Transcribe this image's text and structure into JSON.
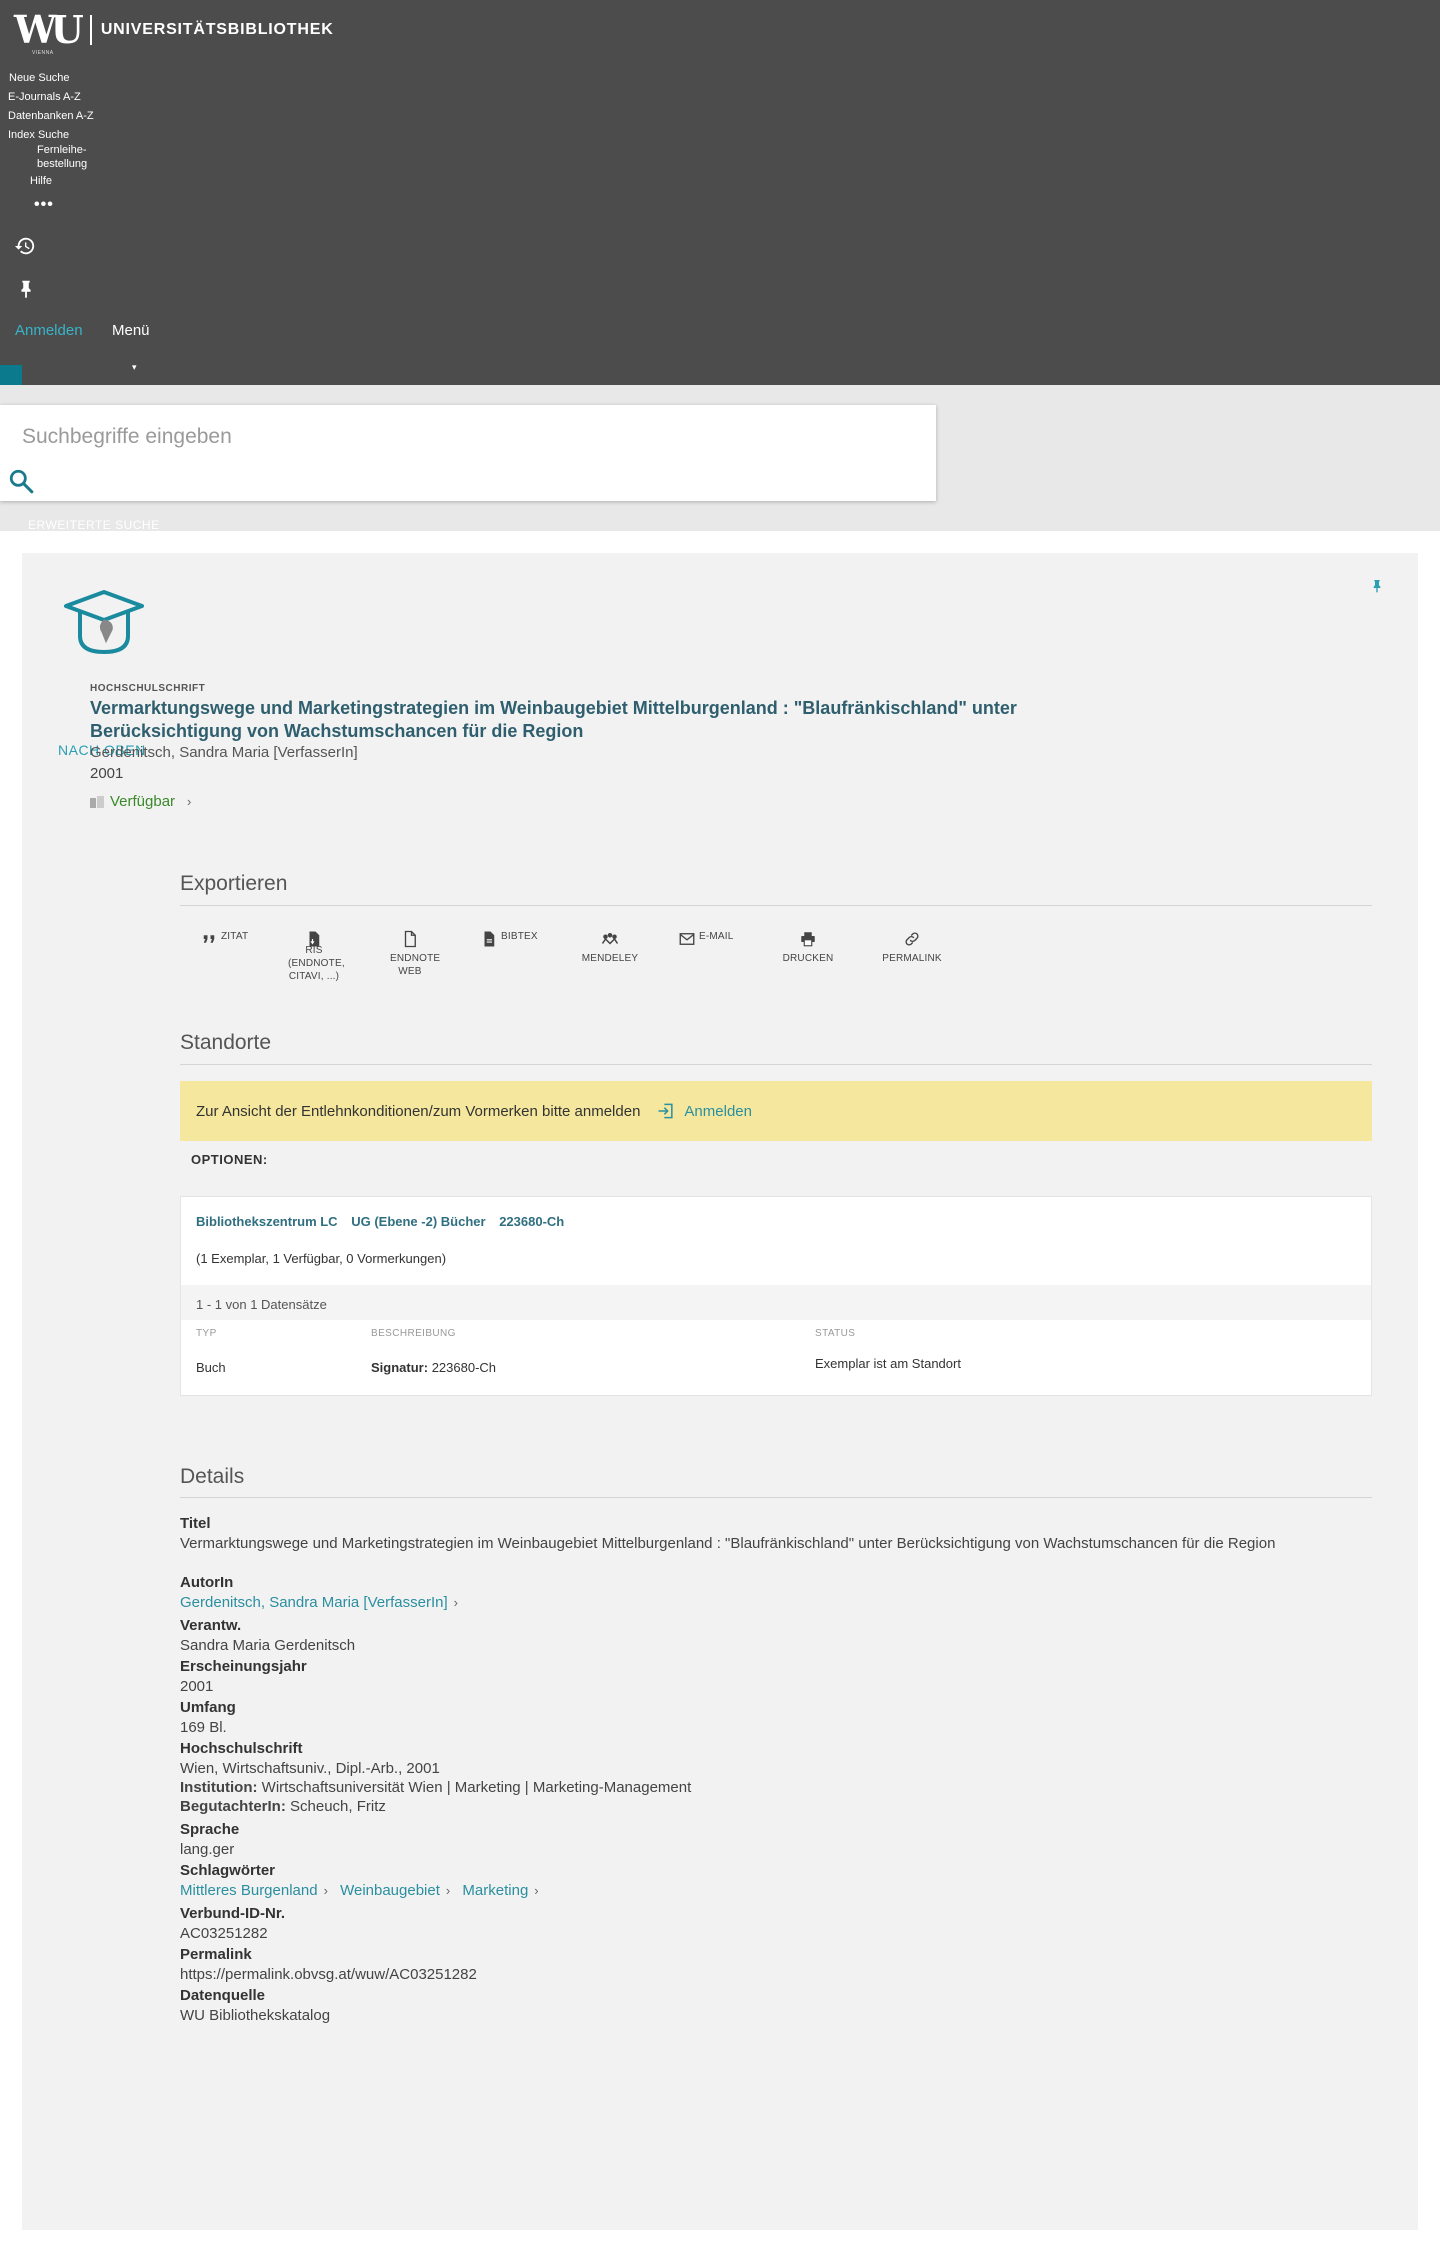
{
  "header": {
    "logo_mark": "WU",
    "logo_sub": "VIENNA",
    "library_name": "UNIVERSITÄTSBIBLIOTHEK",
    "nav": [
      "Neue Suche",
      "E-Journals A-Z",
      "Datenbanken A-Z",
      "Index Suche",
      "Fernleihe-bestellung",
      "Hilfe"
    ],
    "more": "•••",
    "login": "Anmelden",
    "menu": "Menü",
    "caret": "▾"
  },
  "search": {
    "placeholder": "Suchbegriffe eingeben",
    "advanced": "ERWEITERTE SUCHE"
  },
  "record": {
    "type": "HOCHSCHULSCHRIFT",
    "title": "Vermarktungswege und Marketingstrategien im Weinbaugebiet Mittelburgenland : \"Blaufränkischland\" unter Berücksichtigung von Wachstumschancen für die Region",
    "author": "Gerdenitsch, Sandra Maria [VerfasserIn]",
    "year": "2001",
    "availability": "Verfügbar",
    "back_to_top": "NACH OBEN",
    "icon_color": "#1a8a9e",
    "available_color": "#3a8a2a"
  },
  "export": {
    "title": "Exportieren",
    "buttons": [
      {
        "icon": "quote-icon",
        "label": "ZITAT"
      },
      {
        "icon": "ris-file-icon",
        "label": "RIS (ENDNOTE, CITAVI, ...)"
      },
      {
        "icon": "endnote-file-icon",
        "label": "ENDNOTE WEB"
      },
      {
        "icon": "bibtex-file-icon",
        "label": "BIBTEX"
      },
      {
        "icon": "mendeley-icon",
        "label": "MENDELEY"
      },
      {
        "icon": "email-icon",
        "label": "E-MAIL"
      },
      {
        "icon": "print-icon",
        "label": "DRUCKEN"
      },
      {
        "icon": "link-icon",
        "label": "PERMALINK"
      }
    ]
  },
  "locations": {
    "title": "Standorte",
    "login_notice": "Zur Ansicht der Entlehnkonditionen/zum Vormerken bitte anmelden",
    "login_button": "Anmelden",
    "options": "OPTIONEN:",
    "library": "Bibliothekszentrum LC",
    "shelf": "UG (Ebene -2) Bücher",
    "call_number": "223680-Ch",
    "summary": "(1 Exemplar, 1 Verfügbar, 0 Vormerkungen)",
    "range": "1 - 1 von 1 Datensätze",
    "columns": [
      "TYP",
      "BESCHREIBUNG",
      "STATUS"
    ],
    "rows": [
      {
        "type": "Buch",
        "desc_label": "Signatur:",
        "desc_value": "223680-Ch",
        "status": "Exemplar ist am Standort"
      }
    ]
  },
  "details": {
    "title": "Details",
    "titel_label": "Titel",
    "titel_value": "Vermarktungswege und Marketingstrategien im Weinbaugebiet Mittelburgenland : \"Blaufränkischland\" unter Berücksichtigung von Wachstumschancen für die Region",
    "autor_label": "AutorIn",
    "autor_value": "Gerdenitsch, Sandra Maria [VerfasserIn]",
    "verantw_label": "Verantw.",
    "verantw_value": "Sandra Maria Gerdenitsch",
    "jahr_label": "Erscheinungsjahr",
    "jahr_value": "2001",
    "umfang_label": "Umfang",
    "umfang_value": "169 Bl.",
    "hochschul_label": "Hochschulschrift",
    "hochschul_value": "Wien, Wirtschaftsuniv., Dipl.-Arb., 2001",
    "institution_label": "Institution:",
    "institution_value": "Wirtschaftsuniversität Wien | Marketing | Marketing-Management",
    "gutachter_label": "BegutachterIn:",
    "gutachter_value": "Scheuch, Fritz",
    "sprache_label": "Sprache",
    "sprache_value": "lang.ger",
    "schlag_label": "Schlagwörter",
    "schlagwoerter": [
      "Mittleres Burgenland",
      "Weinbaugebiet",
      "Marketing"
    ],
    "verbund_label": "Verbund-ID-Nr.",
    "verbund_value": "AC03251282",
    "permalink_label": "Permalink",
    "permalink_value": "https://permalink.obvsg.at/wuw/AC03251282",
    "quelle_label": "Datenquelle",
    "quelle_value": "WU Bibliothekskatalog"
  },
  "colors": {
    "header_bg": "#4c4c4c",
    "accent_teal": "#2a8fa0",
    "banner_yellow": "#f5e89e",
    "card_bg": "#f2f2f2"
  }
}
